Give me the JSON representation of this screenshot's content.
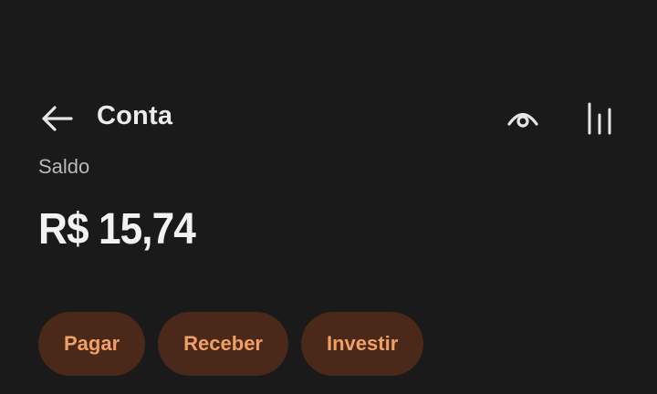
{
  "header": {
    "back_icon": "arrow-left-icon",
    "title": "Conta",
    "visibility_icon": "eye-icon",
    "chart_icon": "bar-chart-icon"
  },
  "balance": {
    "label": "Saldo",
    "amount": "R$ 15,74"
  },
  "actions": [
    {
      "label": "Pagar"
    },
    {
      "label": "Receber"
    },
    {
      "label": "Investir"
    }
  ],
  "colors": {
    "background": "#1a1a1a",
    "pill_background": "#4a281a",
    "pill_text": "#f0a064",
    "primary_text": "#ececec",
    "secondary_text": "#b9b9b9"
  }
}
